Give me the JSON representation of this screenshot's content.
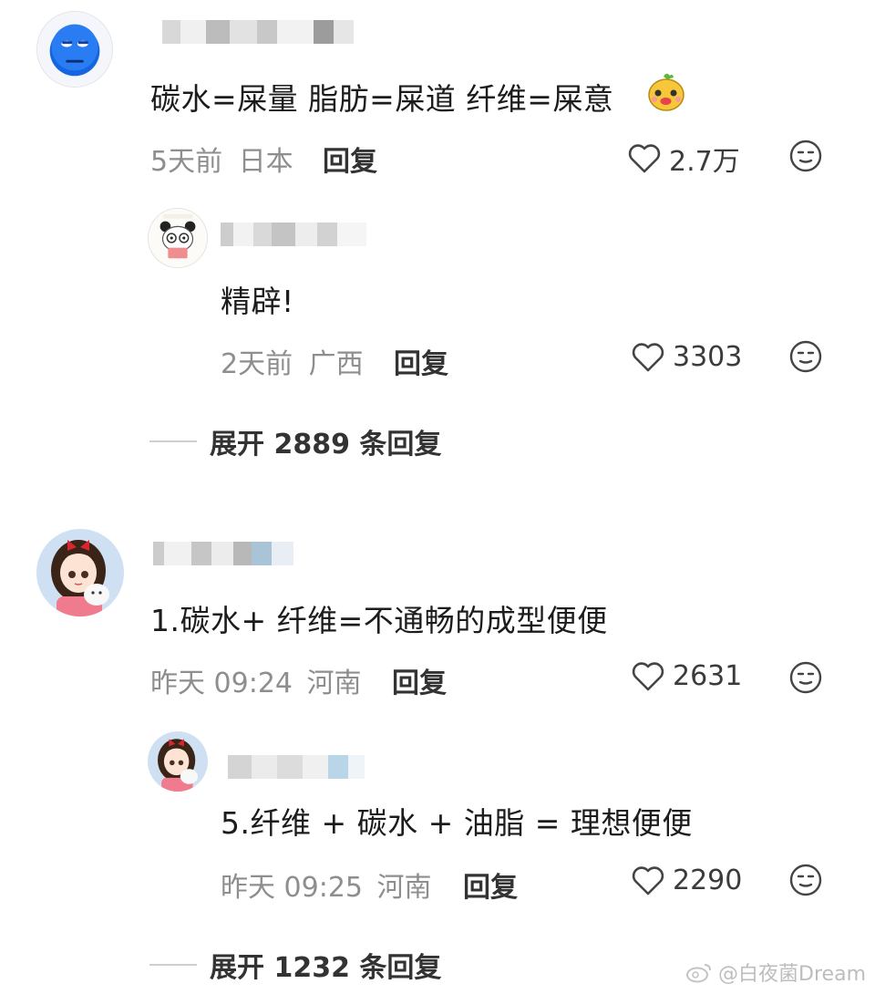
{
  "comments": [
    {
      "text": "碳水=屎量  脂肪=屎道 纤维=屎意",
      "time": "5天前",
      "location": "日本",
      "reply_label": "回复",
      "likes": "2.7万",
      "avatar_icon": "blue-smiley-avatar",
      "emoji_icon": "yellow-dog-emoji"
    },
    {
      "text": "精辟!",
      "time": "2天前",
      "location": "广西",
      "reply_label": "回复",
      "likes": "3303",
      "avatar_icon": "panda-avatar"
    },
    {
      "text": "1.碳水+ 纤维=不通畅的成型便便",
      "time": "昨天 09:24",
      "location": "河南",
      "reply_label": "回复",
      "likes": "2631",
      "avatar_icon": "anime-girl-avatar"
    },
    {
      "text": "5.纤维 + 碳水 + 油脂 = 理想便便",
      "time": "昨天 09:25",
      "location": "河南",
      "reply_label": "回复",
      "likes": "2290",
      "avatar_icon": "anime-girl-avatar"
    }
  ],
  "expand_1": "展开 2889 条回复",
  "expand_2": "展开 1232 条回复",
  "watermark": "@白夜菌Dream",
  "colors": {
    "meta": "#8e8e8e",
    "text": "#1c1c1c",
    "line": "#cfcfcf"
  }
}
